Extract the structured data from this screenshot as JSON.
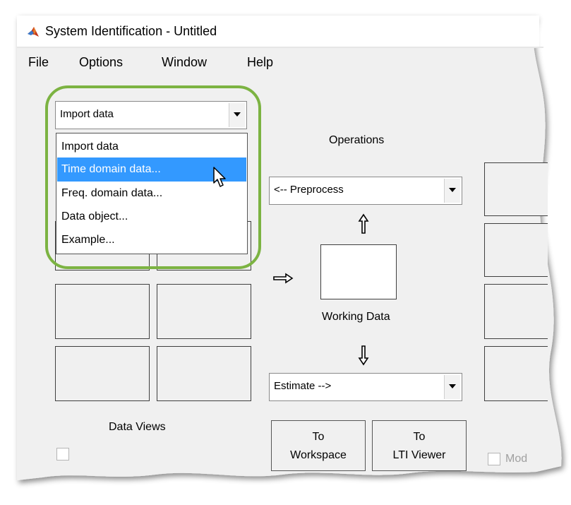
{
  "window": {
    "title": "System Identification - Untitled",
    "app_icon": "matlab-icon"
  },
  "menubar": {
    "items": [
      "File",
      "Options",
      "Window",
      "Help"
    ]
  },
  "import_combo": {
    "value": "Import data"
  },
  "import_dropdown": {
    "options": [
      "Import data",
      "Time domain data...",
      "Freq. domain data...",
      "Data object...",
      "Example..."
    ],
    "highlighted_index": 1
  },
  "operations": {
    "label": "Operations"
  },
  "preprocess_combo": {
    "value": "<-- Preprocess"
  },
  "estimate_combo": {
    "value": "Estimate -->"
  },
  "working_data": {
    "label": "Working Data"
  },
  "data_views": {
    "label": "Data Views"
  },
  "buttons": {
    "to_workspace": [
      "To",
      "Workspace"
    ],
    "to_lti_viewer": [
      "To",
      "LTI Viewer"
    ]
  },
  "model_views": {
    "label_partial": "Mod"
  },
  "colors": {
    "highlight": "#3399ff",
    "callout_ring": "#7cb342",
    "panel": "#f0f0f0"
  }
}
